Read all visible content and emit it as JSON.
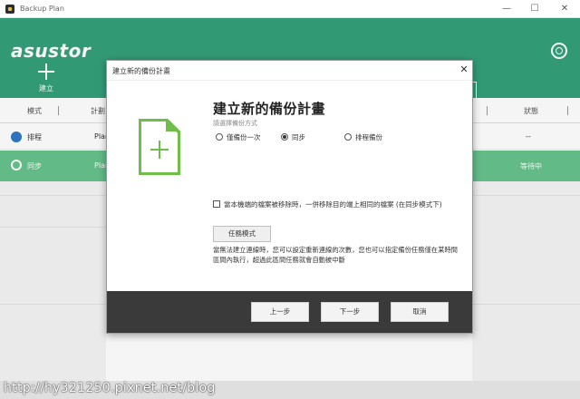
{
  "window": {
    "title": "Backup Plan",
    "minimize": "—",
    "maximize": "☐",
    "close": "✕"
  },
  "header": {
    "logo": "asustor",
    "create_label": "建立"
  },
  "table": {
    "columns": [
      "模式",
      "計劃",
      "狀態"
    ],
    "rows": [
      {
        "mode": "排程",
        "plan": "Plan",
        "status": "--"
      },
      {
        "mode": "同步",
        "plan": "Plan",
        "status": "等待中"
      }
    ]
  },
  "dialog": {
    "title": "建立新的備份計畫",
    "close": "✕",
    "heading": "建立新的備份計畫",
    "subtitle": "請選擇備份方式",
    "options": [
      {
        "label": "僅備份一次",
        "selected": false
      },
      {
        "label": "同步",
        "selected": true
      },
      {
        "label": "排程備份",
        "selected": false
      }
    ],
    "checkbox_label": "當本機端的檔案被移除時，一併移除目的端上相同的檔案 (在同步模式下)",
    "checkbox_checked": false,
    "task_mode_button": "任務模式",
    "note": "當無法建立連線時，您可以設定重新連線的次數，您也可以指定備份任務僅在某時間區間內執行，超過此區間任務就會自動被中斷",
    "buttons": {
      "prev": "上一步",
      "next": "下一步",
      "cancel": "取消"
    }
  },
  "watermark": "http://hy321250.pixnet.net/blog",
  "colors": {
    "brand_green": "#35a07a",
    "selected_row": "#66c28d",
    "doc_icon": "#6fbe4a",
    "footer": "#3a3a3a"
  }
}
